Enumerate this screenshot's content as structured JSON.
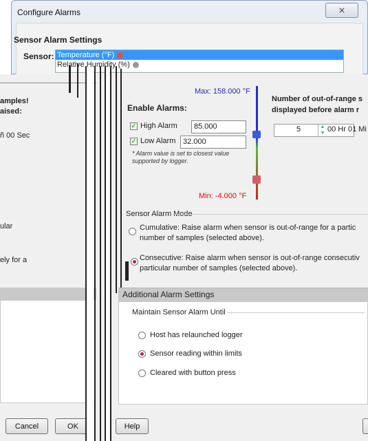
{
  "window": {
    "title": "Configure Alarms",
    "close_glyph": "⨯"
  },
  "sensor_settings": {
    "group_title": "Sensor Alarm Settings",
    "sensor_label": "Sensor:",
    "options": [
      "Temperature (°F)",
      "Relative Humidity (%)"
    ],
    "selected": "Temperature (°F)"
  },
  "left_fragments": {
    "samples": "amples!",
    "raised": "aised:",
    "sec": "ñ 00 Sec",
    "ular": "ular",
    "ely": "ely for a"
  },
  "enable_alarms": {
    "title": "Enable Alarms:",
    "high": {
      "label": "High Alarm",
      "value": "85.000",
      "checked": true
    },
    "low": {
      "label": "Low Alarm",
      "value": "32.000",
      "checked": true
    },
    "note": "* Alarm value is set to closest value supported by logger."
  },
  "slider": {
    "max_label": "Max: 158.000 °F",
    "min_label": "Min: -4.000 °F",
    "max": 158.0,
    "min": -4.0,
    "high_value": 85.0,
    "low_value": 32.0
  },
  "out_of_range": {
    "title": "Number of out-of-range s displayed before alarm r",
    "count": "5",
    "interval": "00 Hr 01 Mi"
  },
  "alarm_mode": {
    "title": "Sensor Alarm Mode",
    "cumulative": "Cumulative: Raise alarm when sensor is out-of-range for a partic number of samples (selected above).",
    "consecutive": "Consecutive: Raise alarm when sensor is out-of-range consecutiv particular number of samples (selected above).",
    "selected": "consecutive"
  },
  "additional": {
    "title": "Additional Alarm Settings",
    "maintain_title": "Maintain Sensor Alarm Until",
    "options": [
      "Host has relaunched logger",
      "Sensor reading within limits",
      "Cleared with button press"
    ],
    "selected": "Sensor reading within limits"
  },
  "buttons": {
    "cancel": "Cancel",
    "ok": "OK",
    "help": "Help"
  },
  "colors": {
    "selection": "#3399ff",
    "max_text": "#2a2aa8",
    "min_text": "#cc1111",
    "radio_selected": "#c2185b"
  }
}
